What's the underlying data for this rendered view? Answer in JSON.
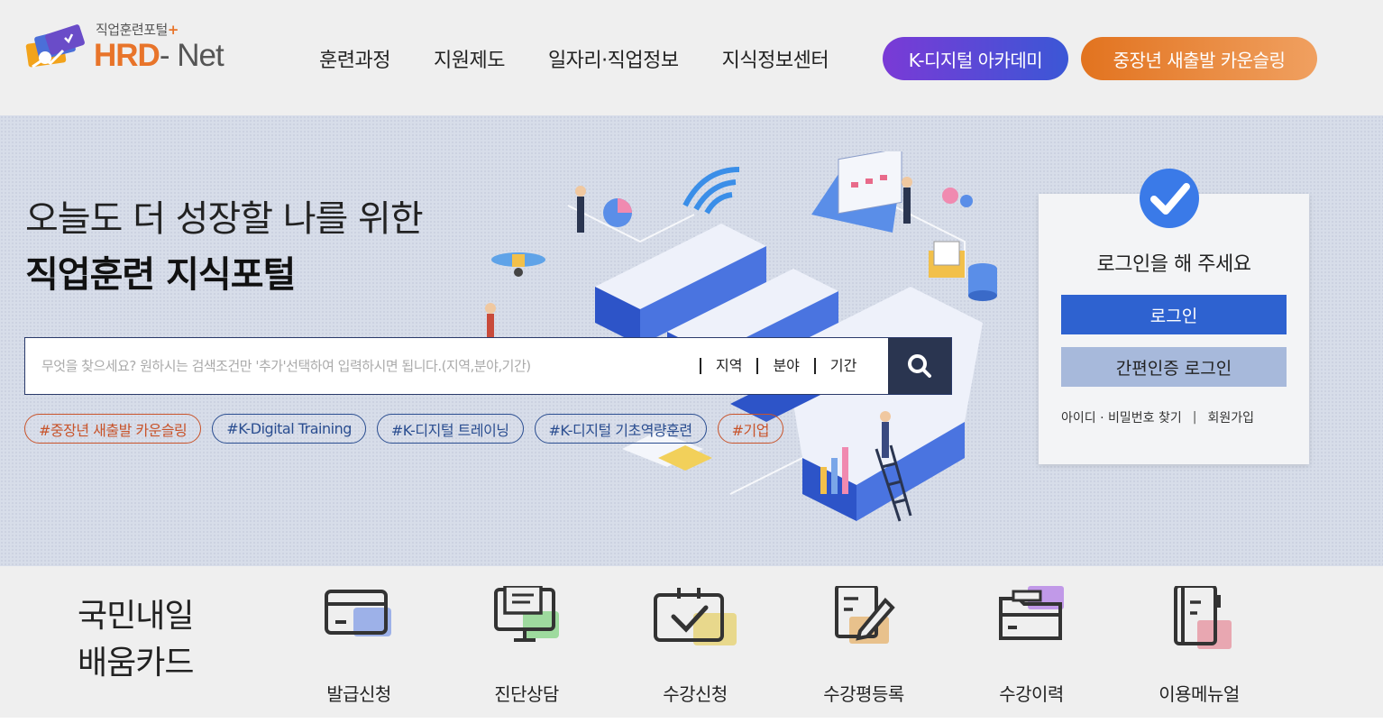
{
  "header": {
    "logo_sub": "직업훈련포털",
    "logo_plus": "+",
    "logo_hrd": "HRD",
    "logo_net": "- Net",
    "nav": [
      "훈련과정",
      "지원제도",
      "일자리·직업정보",
      "지식정보센터"
    ],
    "pill_kdigital": "K-디지털 아카데미",
    "pill_counsel": "중장년 새출발 카운슬링"
  },
  "hero": {
    "title_line1": "오늘도 더 성장할 나를 위한",
    "title_line2": "직업훈련 지식포털",
    "search_placeholder": "무엇을 찾으세요? 원하시는 검색조건만 '추가'선택하여 입력하시면 됩니다.(지역,분야,기간)",
    "filters": [
      "지역",
      "분야",
      "기간"
    ],
    "tags": [
      {
        "label": "#중장년 새출발 카운슬링",
        "color": "#c8532a"
      },
      {
        "label": "#K-Digital Training",
        "color": "#2a4d90"
      },
      {
        "label": "#K-디지털 트레이닝",
        "color": "#2a4d90"
      },
      {
        "label": "#K-디지털 기초역량훈련",
        "color": "#2a4d90"
      },
      {
        "label": "#기업",
        "color": "#c8532a"
      }
    ]
  },
  "login": {
    "message": "로그인을 해 주세요",
    "login_button": "로그인",
    "easy_login_button": "간편인증 로그인",
    "find_account": "아이디 · 비밀번호 찾기",
    "separator": "|",
    "signup": "회원가입"
  },
  "card": {
    "title_line1": "국민내일",
    "title_line2": "배움카드",
    "menu": [
      {
        "label": "발급신청",
        "icon": "card-icon",
        "accent": "#8ea6e6"
      },
      {
        "label": "진단상담",
        "icon": "monitor-icon",
        "accent": "#8fd68f"
      },
      {
        "label": "수강신청",
        "icon": "checkbox-icon",
        "accent": "#e6d47a"
      },
      {
        "label": "수강평등록",
        "icon": "edit-icon",
        "accent": "#e6b87a"
      },
      {
        "label": "수강이력",
        "icon": "folder-icon",
        "accent": "#b88ae6"
      },
      {
        "label": "이용메뉴얼",
        "icon": "book-icon",
        "accent": "#e69aa6"
      }
    ]
  }
}
